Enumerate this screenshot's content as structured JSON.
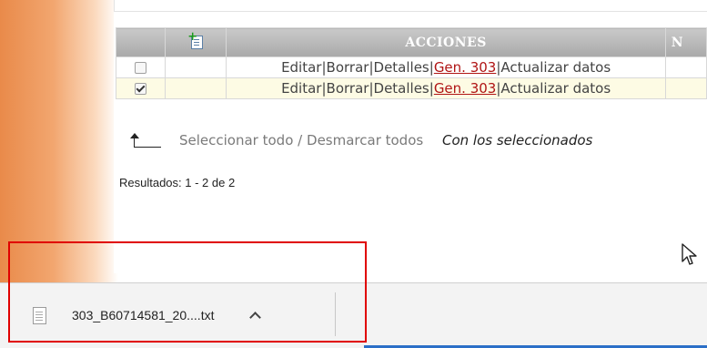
{
  "table": {
    "header": {
      "actions": "ACCIONES",
      "next_col": "N"
    },
    "rows": [
      {
        "checked": false,
        "actions": {
          "edit": "Editar",
          "delete": "Borrar",
          "details": "Detalles",
          "gen": "Gen. 303",
          "update": "Actualizar datos"
        },
        "separator": "|"
      },
      {
        "checked": true,
        "actions": {
          "edit": "Editar",
          "delete": "Borrar",
          "details": "Detalles",
          "gen": "Gen. 303",
          "update": "Actualizar datos"
        },
        "separator": "|"
      }
    ]
  },
  "selection": {
    "select_all": "Seleccionar todo",
    "divider": "/",
    "deselect_all": "Desmarcar todos",
    "with_selected": "Con los seleccionados"
  },
  "results": "Resultados: 1 - 2 de 2",
  "download_bar": {
    "file_name": "303_B60714581_20....txt",
    "file_icon": "text-file-icon",
    "toggle_icon": "chevron-up-icon"
  },
  "colors": {
    "accent_orange": "#e98a4a",
    "link_red": "#b01515",
    "highlight_red": "#e00000",
    "selected_row": "#fdfbe4"
  }
}
